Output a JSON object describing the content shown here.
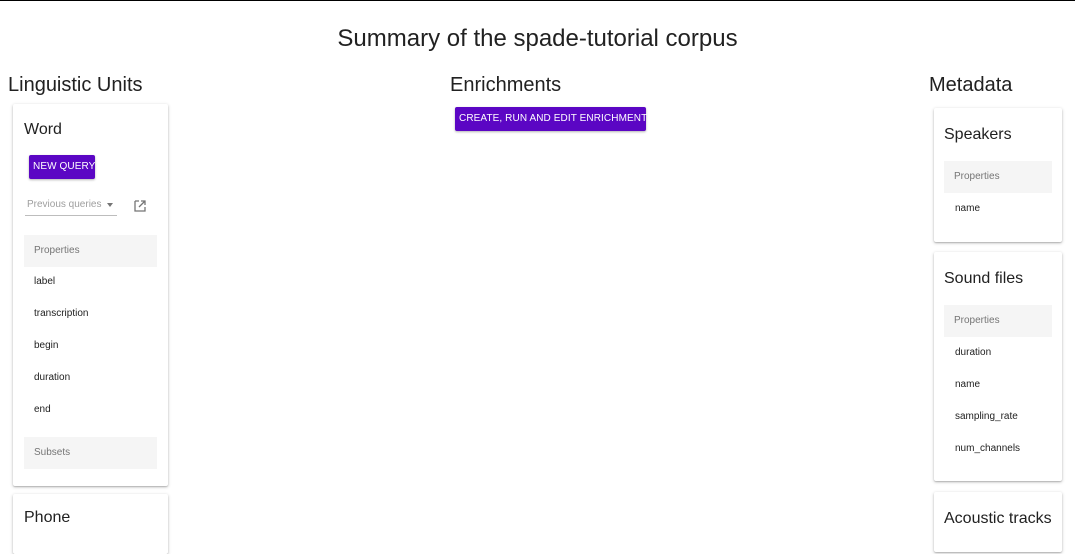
{
  "page": {
    "title": "Summary of the spade-tutorial corpus"
  },
  "columns": {
    "linguistic_units": "Linguistic Units",
    "enrichments": "Enrichments",
    "metadata": "Metadata"
  },
  "enrichments": {
    "button_label": "Create, run and edit enrichments"
  },
  "word_card": {
    "title": "Word",
    "new_query_label": "New query",
    "previous_queries_placeholder": "Previous queries",
    "properties_header": "Properties",
    "properties": [
      "label",
      "transcription",
      "begin",
      "duration",
      "end"
    ],
    "subsets_header": "Subsets"
  },
  "phone_card": {
    "title": "Phone"
  },
  "speakers_card": {
    "title": "Speakers",
    "properties_header": "Properties",
    "properties": [
      "name"
    ]
  },
  "sound_files_card": {
    "title": "Sound files",
    "properties_header": "Properties",
    "properties": [
      "duration",
      "name",
      "sampling_rate",
      "num_channels"
    ]
  },
  "acoustic_tracks_card": {
    "title": "Acoustic tracks"
  },
  "colors": {
    "accent": "#5b06c4",
    "prop_header_bg": "#f5f5f5"
  }
}
